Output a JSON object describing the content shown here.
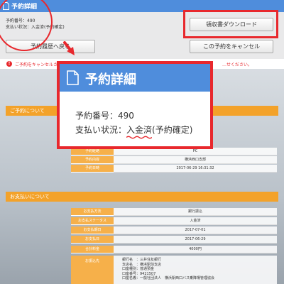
{
  "header": {
    "title": "予約詳細"
  },
  "info": {
    "reservation_number": "予約番号：490",
    "payment_status": "支払い状況：入金済(予約確定)"
  },
  "buttons": {
    "receipt": "領収書ダウンロード",
    "history": "予約履歴へ戻る",
    "cancel": "この予約をキャンセル"
  },
  "notice": {
    "left": "ご予約をキャンセルされる場合は…",
    "right": "…せください。"
  },
  "sections": {
    "reservation": "ご予約について",
    "payment": "お支払いについて"
  },
  "reservation_table": [
    {
      "label": "予約経路",
      "value": "PC"
    },
    {
      "label": "予約内容",
      "value": "横浜西口支部"
    },
    {
      "label": "予約日時",
      "value": "2017-06-29 16:31:32"
    }
  ],
  "payment_table": [
    {
      "label": "お支払方法",
      "value": "銀行振込"
    },
    {
      "label": "お支払ステータス",
      "value": "入金済"
    },
    {
      "label": "お支払期日",
      "value": "2017-07-01"
    },
    {
      "label": "お支払日",
      "value": "2017-06-29"
    },
    {
      "label": "合計料金",
      "value": "4000円"
    }
  ],
  "bank": {
    "label": "お振込先",
    "lines": [
      "銀行名　：三井住友銀行",
      "支店名　：横浜駅前支店",
      "口座種別：普通預金",
      "口座番号：9421507",
      "口座名義：一般社団法人　横浜駅西口バス乗降場管理協会"
    ]
  },
  "popup": {
    "title": "予約詳細",
    "reservation_number_label": "予約番号：",
    "reservation_number": "490",
    "payment_status_label": "支払い状況：",
    "payment_status_value": "入金済",
    "payment_status_note": "(予約確定)"
  },
  "colors": {
    "header_blue": "#4f8ddc",
    "highlight_red": "#e8282d",
    "section_orange": "#f3a22a"
  },
  "icons": {
    "title": "document-icon",
    "arrow": "arrow-down-right-icon",
    "warning": "warning-icon"
  }
}
